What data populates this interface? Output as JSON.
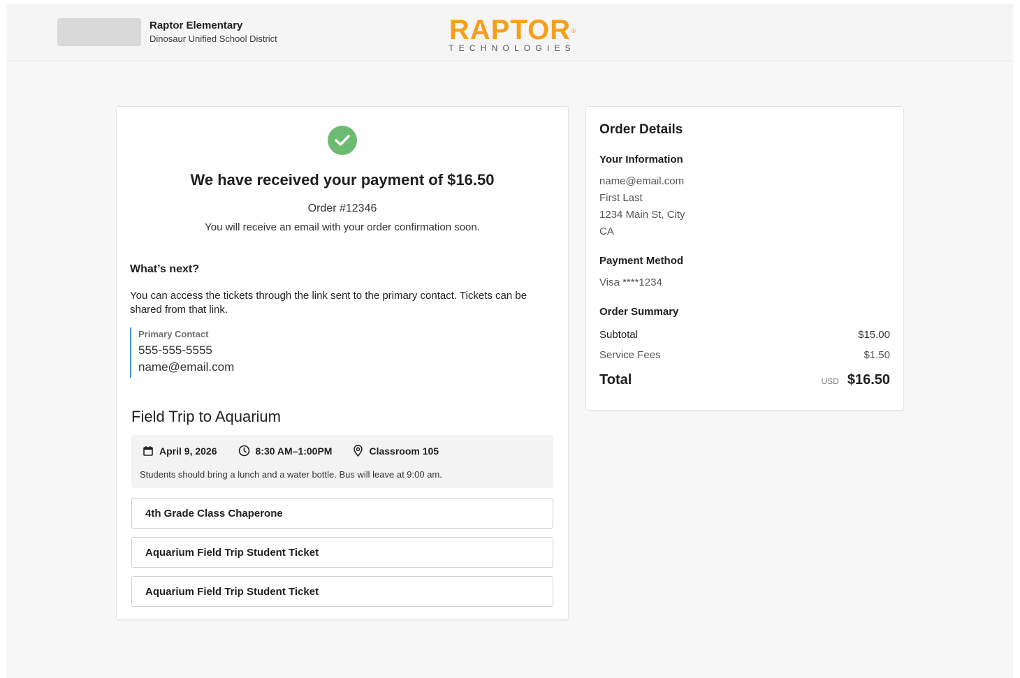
{
  "header": {
    "school_name": "Raptor Elementary",
    "district_name": "Dinosaur Unified School District",
    "brand_name": "RAPTOR",
    "brand_tagline": "TECHNOLOGIES",
    "brand_reg": "®"
  },
  "confirmation": {
    "headline": "We have received your payment of $16.50",
    "order_number": "Order #12346",
    "email_notice": "You will receive an email with your order confirmation soon.",
    "next_title": "What’s next?",
    "next_body": "You can access the tickets through the link sent to the primary contact. Tickets can be shared from that link.",
    "contact_label": "Primary Contact",
    "contact_phone": "555-555-5555",
    "contact_email": "name@email.com"
  },
  "event": {
    "title": "Field Trip to Aquarium",
    "date": "April 9, 2026",
    "time": "8:30 AM–1:00PM",
    "location": "Classroom 105",
    "note": "Students should bring a lunch and a water bottle. Bus will leave at 9:00 am.",
    "tickets": [
      "4th Grade Class Chaperone",
      "Aquarium Field Trip Student Ticket",
      "Aquarium Field Trip Student Ticket"
    ]
  },
  "order_details": {
    "title": "Order Details",
    "your_info_title": "Your Information",
    "email": "name@email.com",
    "name": "First Last",
    "address": "1234 Main St, City",
    "state": "CA",
    "payment_title": "Payment Method",
    "payment_value": "Visa ****1234",
    "summary_title": "Order Summary",
    "subtotal_label": "Subtotal",
    "subtotal_value": "$15.00",
    "fees_label": "Service Fees",
    "fees_value": "$1.50",
    "total_label": "Total",
    "currency": "USD",
    "total_value": "$16.50"
  },
  "colors": {
    "brand_orange": "#f6a01a",
    "success_green": "#6dbb72",
    "contact_accent": "#4a90d9"
  },
  "icons": {
    "success": "check-circle-icon",
    "date": "calendar-icon",
    "time": "clock-icon",
    "location": "map-pin-icon"
  }
}
